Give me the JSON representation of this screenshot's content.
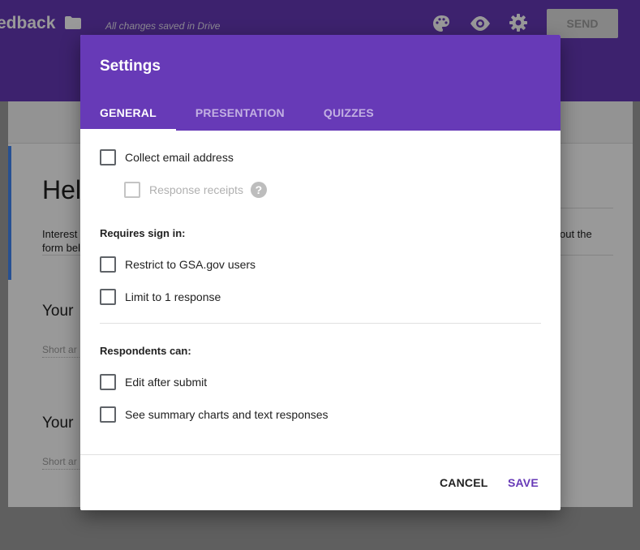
{
  "background": {
    "form_title": "edback",
    "save_status": "All changes saved in Drive",
    "send_label": "SEND",
    "form_heading": "Hel",
    "description_line1": "Interest",
    "description_line2": "form bel",
    "description_right": "out the",
    "question1": "Your",
    "question1_hint": "Short ar",
    "question2": "Your",
    "question2_hint": "Short ar",
    "header_color": "#673ab7"
  },
  "dialog": {
    "title": "Settings",
    "tabs": [
      {
        "label": "GENERAL",
        "active": true
      },
      {
        "label": "PRESENTATION",
        "active": false
      },
      {
        "label": "QUIZZES",
        "active": false
      }
    ],
    "options": {
      "collect_email": {
        "label": "Collect email address",
        "checked": false
      },
      "response_receipts": {
        "label": "Response receipts",
        "checked": false,
        "disabled": true
      },
      "requires_sign_in_title": "Requires sign in:",
      "restrict_domain": {
        "label": "Restrict to GSA.gov users",
        "checked": false
      },
      "limit_one": {
        "label": "Limit to 1 response",
        "checked": false
      },
      "respondents_can_title": "Respondents can:",
      "edit_after_submit": {
        "label": "Edit after submit",
        "checked": false
      },
      "see_summary": {
        "label": "See summary charts and text responses",
        "checked": false
      }
    },
    "help_glyph": "?",
    "cancel_label": "CANCEL",
    "save_label": "SAVE",
    "accent_color": "#673ab7"
  }
}
